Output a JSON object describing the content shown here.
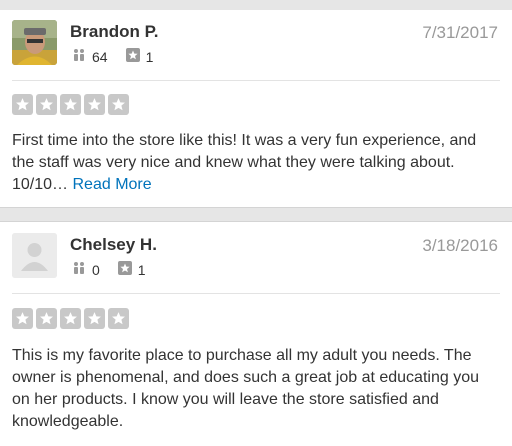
{
  "reviews": [
    {
      "name": "Brandon P.",
      "date": "7/31/2017",
      "friends": "64",
      "review_count": "1",
      "rating": 5,
      "text": "First time into the store like this! It was a very fun experience, and the staff was very nice and knew what they were talking about. 10/10…",
      "read_more": "Read More"
    },
    {
      "name": "Chelsey H.",
      "date": "3/18/2016",
      "friends": "0",
      "review_count": "1",
      "rating": 5,
      "text": "This is my favorite place to purchase all my adult you needs. The owner is phenomenal, and does such a great job at educating you on her products. I know you will leave the store satisfied and knowledgeable."
    }
  ],
  "colors": {
    "star_gray": "#c8c8c8",
    "link_blue": "#0073bb",
    "date_gray": "#999999"
  }
}
